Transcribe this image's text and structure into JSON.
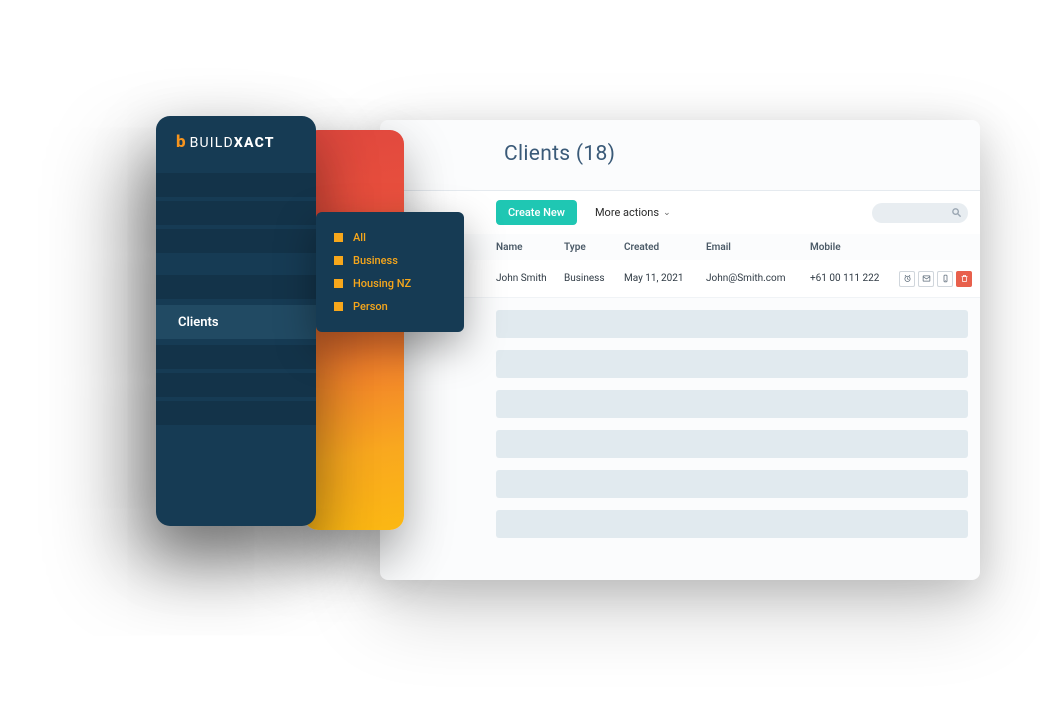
{
  "brand": {
    "icon_letter": "b",
    "name_light": "BUILD",
    "name_bold": "XACT"
  },
  "sidebar": {
    "active_label": "Clients"
  },
  "filters": {
    "items": [
      {
        "label": "All"
      },
      {
        "label": "Business"
      },
      {
        "label": "Housing NZ"
      },
      {
        "label": "Person"
      }
    ]
  },
  "page": {
    "title": "Clients (18)",
    "create_label": "Create New",
    "more_actions_label": "More actions"
  },
  "columns": {
    "name": "Name",
    "type": "Type",
    "created": "Created",
    "email": "Email",
    "mobile": "Mobile"
  },
  "rows": [
    {
      "name": "John Smith",
      "type": "Business",
      "created": "May 11, 2021",
      "email": "John@Smith.com",
      "mobile": "+61 00 111 222"
    }
  ]
}
